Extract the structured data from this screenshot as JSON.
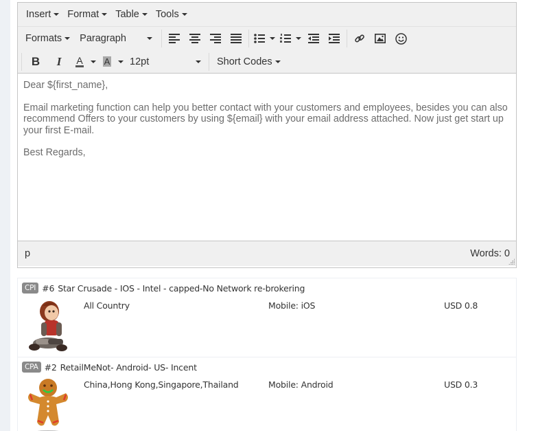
{
  "editor": {
    "menubar": [
      {
        "label": "Insert"
      },
      {
        "label": "Format"
      },
      {
        "label": "Table"
      },
      {
        "label": "Tools"
      }
    ],
    "toolbar": {
      "formats_label": "Formats",
      "block_format": "Paragraph",
      "font_size": "12pt",
      "short_codes_label": "Short Codes",
      "bold_label": "B",
      "italic_label": "I",
      "text_color_label": "A",
      "bg_color_label": "A",
      "icons": [
        "align-left-icon",
        "align-center-icon",
        "align-right-icon",
        "align-justify-icon",
        "bullet-list-icon",
        "numbered-list-icon",
        "outdent-icon",
        "indent-icon",
        "link-icon",
        "image-icon",
        "emoticon-icon"
      ]
    },
    "content": {
      "greeting": "Dear ${first_name},",
      "body": "Email marketing function can help you better contact with your customers and employees, besides you can also recommend Offers to your customers by using ${email} with your email address attached. Now just get start up your first E-mail.",
      "closing": "Best Regards,"
    },
    "statusbar": {
      "path": "p",
      "word_count": "Words: 0"
    }
  },
  "offers": [
    {
      "badge": "CPI",
      "id": "#6",
      "name": "Star Crusade - IOS - Intel - capped-No Network re-brokering",
      "country": "All Country",
      "platform": "Mobile: iOS",
      "payout": "USD 0.8",
      "thumbnail": "girl-character-image"
    },
    {
      "badge": "CPA",
      "id": "#2",
      "name": "RetailMeNot- Android- US- Incent",
      "country": "China,Hong Kong,Singapore,Thailand",
      "platform": "Mobile: Android",
      "payout": "USD 0.3",
      "thumbnail": "gingerbread-man-image"
    }
  ]
}
